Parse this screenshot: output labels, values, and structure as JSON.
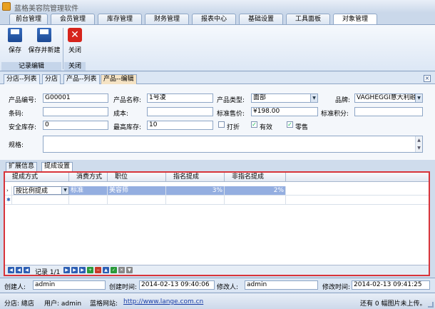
{
  "app": {
    "title": "蓝格美容院管理软件"
  },
  "menu_tabs": [
    "前台管理",
    "会员管理",
    "库存管理",
    "财务管理",
    "报表中心",
    "基础设置",
    "工具面板",
    "对象管理"
  ],
  "ribbon": {
    "buttons": {
      "save": "保存",
      "save_new": "保存并新建",
      "close": "关闭"
    },
    "groups": {
      "edit": "记录编辑",
      "close": "关闭"
    }
  },
  "doc_tabs": [
    "分店--列表",
    "分店",
    "产品--列表",
    "产品--编辑"
  ],
  "form": {
    "code_label": "产品编号:",
    "code_value": "G00001",
    "name_label": "产品名称:",
    "name_value": "1号凌",
    "type_label": "产品类型:",
    "type_value": "面部",
    "brand_label": "品牌:",
    "brand_value": "VAGHEGGI意大利融汇",
    "barcode_label": "条码:",
    "barcode_value": "",
    "cost_label": "成本:",
    "cost_value": "",
    "price_label": "标准售价:",
    "price_value": "¥198.00",
    "points_label": "标准积分:",
    "points_value": "",
    "safe_stock_label": "安全库存:",
    "safe_stock_value": "0",
    "max_stock_label": "最高库存:",
    "max_stock_value": "10",
    "discount_label": "打折",
    "discount_checked": false,
    "valid_label": "有效",
    "valid_checked": true,
    "retail_label": "零售",
    "retail_checked": true,
    "spec_label": "规格:",
    "spec_value": ""
  },
  "sub_tabs": [
    "扩展信息",
    "提成设置"
  ],
  "grid": {
    "headers": [
      "提成方式",
      "消费方式",
      "职位",
      "指名提成",
      "非指名提成"
    ],
    "rows": [
      {
        "method": "按比例提成",
        "consume": "标准",
        "position": "美容师",
        "named": "3%",
        "unnamed": "2%"
      }
    ],
    "nav_label": "记录 1/1"
  },
  "audit": {
    "creator_label": "创建人:",
    "creator": "admin",
    "created_label": "创建时间:",
    "created": "2014-02-13 09:40:06",
    "modifier_label": "修改人:",
    "modifier": "admin",
    "modified_label": "修改时间:",
    "modified": "2014-02-13 09:41:25"
  },
  "status": {
    "branch": "分店: 總店",
    "user": "用户: admin",
    "site_label": "蓝格网站:",
    "site_url": "http://www.lange.com.cn",
    "upload": "还有 0 幅图片未上传。"
  }
}
